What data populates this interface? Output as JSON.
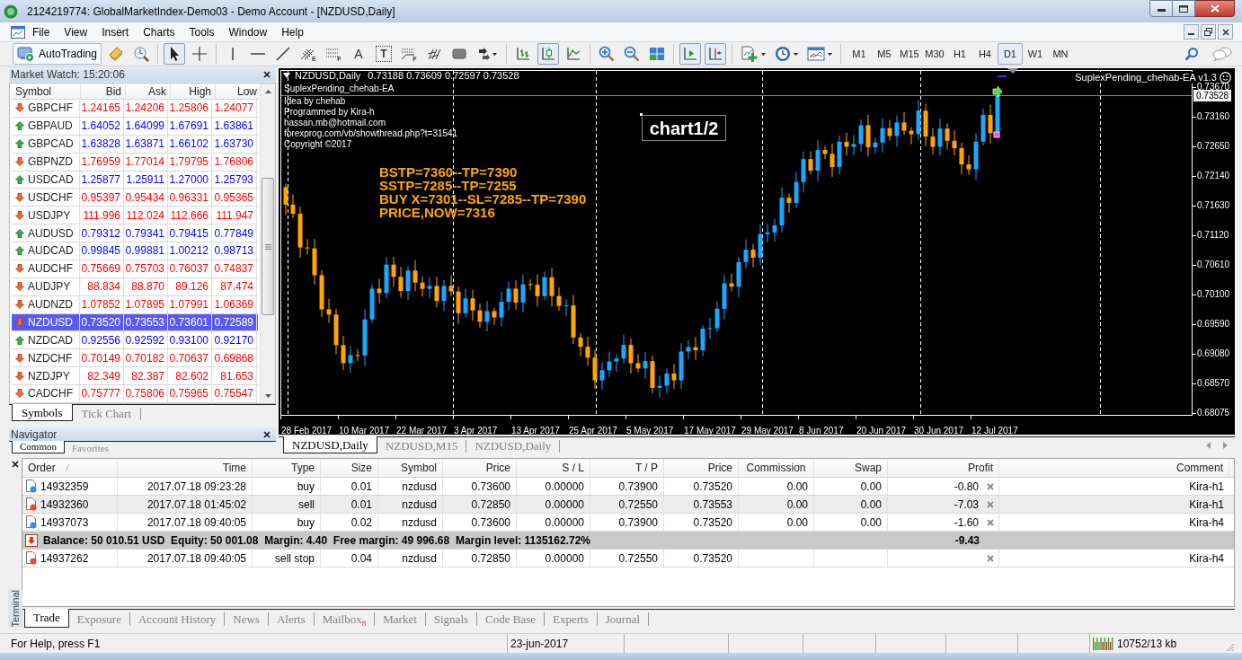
{
  "window": {
    "title": "2124219774: GlobalMarketIndex-Demo03 - Demo Account - [NZDUSD,Daily]"
  },
  "menu": [
    "File",
    "View",
    "Insert",
    "Charts",
    "Tools",
    "Window",
    "Help"
  ],
  "toolbar": {
    "groups": [
      [
        {
          "kind": "autotrading",
          "label": "AutoTrading"
        },
        {
          "kind": "new-order"
        },
        {
          "kind": "tester"
        }
      ],
      [
        {
          "kind": "cursor",
          "selected": true
        },
        {
          "kind": "crosshair",
          "selected": false
        }
      ],
      [
        {
          "kind": "vline"
        },
        {
          "kind": "hline"
        },
        {
          "kind": "trendline"
        },
        {
          "kind": "channel",
          "label": "E"
        },
        {
          "kind": "fibo",
          "label": "F"
        },
        {
          "kind": "text",
          "label": "A"
        },
        {
          "kind": "text-label",
          "label": "T"
        },
        {
          "kind": "fan",
          "label": "F"
        },
        {
          "kind": "gann"
        },
        {
          "kind": "rectangle"
        },
        {
          "kind": "arrows-menu"
        }
      ],
      [
        {
          "kind": "bars",
          "selected": false
        },
        {
          "kind": "candles",
          "selected": true
        },
        {
          "kind": "line",
          "selected": false
        }
      ],
      [
        {
          "kind": "zoom-in"
        },
        {
          "kind": "zoom-out"
        },
        {
          "kind": "tile"
        }
      ],
      [
        {
          "kind": "autoscroll",
          "selected": true
        },
        {
          "kind": "shift",
          "selected": true
        }
      ],
      [
        {
          "kind": "indicators"
        },
        {
          "kind": "periods"
        },
        {
          "kind": "templates"
        }
      ]
    ],
    "timeframes": [
      {
        "label": "M1",
        "selected": false
      },
      {
        "label": "M5",
        "selected": false
      },
      {
        "label": "M15",
        "selected": false
      },
      {
        "label": "M30",
        "selected": false
      },
      {
        "label": "H1",
        "selected": false
      },
      {
        "label": "H4",
        "selected": false
      },
      {
        "label": "D1",
        "selected": true
      },
      {
        "label": "W1",
        "selected": false
      },
      {
        "label": "MN",
        "selected": false
      }
    ]
  },
  "market_watch": {
    "title": "Market Watch: 15:20:06",
    "columns": [
      "Symbol",
      "Bid",
      "Ask",
      "High",
      "Low"
    ],
    "rows": [
      {
        "symbol": "GBPCHF",
        "bid": "1.24165",
        "ask": "1.24206",
        "high": "1.25806",
        "low": "1.24077",
        "up": false,
        "selected": false
      },
      {
        "symbol": "GBPAUD",
        "bid": "1.64052",
        "ask": "1.64099",
        "high": "1.67691",
        "low": "1.63861",
        "up": true,
        "selected": false
      },
      {
        "symbol": "GBPCAD",
        "bid": "1.63828",
        "ask": "1.63871",
        "high": "1.66102",
        "low": "1.63730",
        "up": true,
        "selected": false
      },
      {
        "symbol": "GBPNZD",
        "bid": "1.76959",
        "ask": "1.77014",
        "high": "1.79795",
        "low": "1.76806",
        "up": false,
        "selected": false
      },
      {
        "symbol": "USDCAD",
        "bid": "1.25877",
        "ask": "1.25911",
        "high": "1.27000",
        "low": "1.25793",
        "up": true,
        "selected": false
      },
      {
        "symbol": "USDCHF",
        "bid": "0.95397",
        "ask": "0.95434",
        "high": "0.96331",
        "low": "0.95365",
        "up": false,
        "selected": false
      },
      {
        "symbol": "USDJPY",
        "bid": "111.996",
        "ask": "112.024",
        "high": "112.666",
        "low": "111.947",
        "up": false,
        "selected": false
      },
      {
        "symbol": "AUDUSD",
        "bid": "0.79312",
        "ask": "0.79341",
        "high": "0.79415",
        "low": "0.77849",
        "up": true,
        "selected": false
      },
      {
        "symbol": "AUDCAD",
        "bid": "0.99845",
        "ask": "0.99881",
        "high": "1.00212",
        "low": "0.98713",
        "up": true,
        "selected": false
      },
      {
        "symbol": "AUDCHF",
        "bid": "0.75669",
        "ask": "0.75703",
        "high": "0.76037",
        "low": "0.74837",
        "up": false,
        "selected": false
      },
      {
        "symbol": "AUDJPY",
        "bid": "88.834",
        "ask": "88.870",
        "high": "89.126",
        "low": "87.474",
        "up": false,
        "selected": false
      },
      {
        "symbol": "AUDNZD",
        "bid": "1.07852",
        "ask": "1.07895",
        "high": "1.07991",
        "low": "1.06369",
        "up": false,
        "selected": false
      },
      {
        "symbol": "NZDUSD",
        "bid": "0.73520",
        "ask": "0.73553",
        "high": "0.73601",
        "low": "0.72589",
        "up": false,
        "selected": true
      },
      {
        "symbol": "NZDCAD",
        "bid": "0.92556",
        "ask": "0.92592",
        "high": "0.93100",
        "low": "0.92170",
        "up": true,
        "selected": false
      },
      {
        "symbol": "NZDCHF",
        "bid": "0.70149",
        "ask": "0.70182",
        "high": "0.70637",
        "low": "0.69868",
        "up": false,
        "selected": false
      },
      {
        "symbol": "NZDJPY",
        "bid": "82.349",
        "ask": "82.387",
        "high": "82.602",
        "low": "81.653",
        "up": false,
        "selected": false
      },
      {
        "symbol": "CADCHF",
        "bid": "0.75777",
        "ask": "0.75806",
        "high": "0.75965",
        "low": "0.75547",
        "up": false,
        "selected": false
      }
    ],
    "tabs": [
      {
        "label": "Symbols",
        "selected": true
      },
      {
        "label": "Tick Chart",
        "selected": false
      }
    ]
  },
  "navigator": {
    "title": "Navigator",
    "tabs": [
      {
        "label": "Common",
        "selected": true
      },
      {
        "label": "Favorites",
        "selected": false
      }
    ]
  },
  "chart": {
    "symbol": "NZDUSD,Daily",
    "ohlc": "0.73188 0.73609 0.72597 0.73528",
    "ea_name": "SuplexPending_chehab-EA",
    "info_lines": [
      "Idea by chehab",
      "Programmed by Kira-h",
      "hassan.mb@hotmail.com",
      "forexprog.com/vb/showthread.php?t=31541",
      "Copyright ©2017"
    ],
    "signal_lines": [
      "BSTP=7360--TP=7390",
      "SSTP=7285--TP=7255",
      "BUY X=7301--SL=7285--TP=7390",
      "PRICE,NOW=7316"
    ],
    "label_box": "chart1/2",
    "ea_badge": "SuplexPending_chehab-EA v1.3",
    "price_labels": [
      "0.73670",
      "0.73160",
      "0.72650",
      "0.72140",
      "0.71630",
      "0.71120",
      "0.70610",
      "0.70100",
      "0.69590",
      "0.69080",
      "0.68570",
      "0.68075"
    ],
    "current_price": "0.73528",
    "date_labels": [
      "28 Feb 2017",
      "10 Mar 2017",
      "22 Mar 2017",
      "3 Apr 2017",
      "13 Apr 2017",
      "25 Apr 2017",
      "5 May 2017",
      "17 May 2017",
      "29 May 2017",
      "8 Jun 2017",
      "20 Jun 2017",
      "30 Jun 2017",
      "12 Jul 2017"
    ]
  },
  "chart_tabs": [
    {
      "label": "NZDUSD,Daily",
      "selected": true
    },
    {
      "label": "NZDUSD,M15",
      "selected": false
    },
    {
      "label": "NZDUSD,Daily",
      "selected": false
    }
  ],
  "terminal": {
    "title": "Terminal",
    "columns": [
      "Order",
      "Time",
      "Type",
      "Size",
      "Symbol",
      "Price",
      "S / L",
      "T / P",
      "Price",
      "Commission",
      "Swap",
      "Profit",
      "Comment"
    ],
    "rows": [
      {
        "kind": "order",
        "color": "#2f8fe0",
        "order": "14932359",
        "time": "2017.07.18 09:23:28",
        "type": "buy",
        "size": "0.01",
        "symbol": "nzdusd",
        "price": "0.73600",
        "sl": "0.00000",
        "tp": "0.73900",
        "current": "0.73520",
        "commission": "0.00",
        "swap": "0.00",
        "profit": "-0.80",
        "comment": "Kira-h1"
      },
      {
        "kind": "order",
        "color": "#e0502a",
        "order": "14932360",
        "time": "2017.07.18 01:45:02",
        "type": "sell",
        "size": "0.01",
        "symbol": "nzdusd",
        "price": "0.72850",
        "sl": "0.00000",
        "tp": "0.72550",
        "current": "0.73553",
        "commission": "0.00",
        "swap": "0.00",
        "profit": "-7.03",
        "comment": "Kira-h1"
      },
      {
        "kind": "order",
        "color": "#2f8fe0",
        "order": "14937073",
        "time": "2017.07.18 09:40:05",
        "type": "buy",
        "size": "0.02",
        "symbol": "nzdusd",
        "price": "0.73600",
        "sl": "0.00000",
        "tp": "0.73900",
        "current": "0.73520",
        "commission": "0.00",
        "swap": "0.00",
        "profit": "-1.60",
        "comment": "Kira-h4"
      },
      {
        "kind": "summary",
        "text": "Balance: 50 010.51 USD  Equity: 50 001.08  Margin: 4.40  Free margin: 49 996.68  Margin level: 1135162.72%",
        "profit": "-9.43"
      },
      {
        "kind": "order",
        "color": "#e0502a",
        "order": "14937262",
        "time": "2017.07.18 09:40:05",
        "type": "sell stop",
        "size": "0.04",
        "symbol": "nzdusd",
        "price": "0.72850",
        "sl": "0.00000",
        "tp": "0.72550",
        "current": "0.73520",
        "comment": "Kira-h4"
      }
    ],
    "tabs": [
      {
        "label": "Trade",
        "selected": true
      },
      {
        "label": "Exposure",
        "selected": false
      },
      {
        "label": "Account History",
        "selected": false
      },
      {
        "label": "News",
        "selected": false
      },
      {
        "label": "Alerts",
        "selected": false
      },
      {
        "label": "Mailbox",
        "selected": false,
        "badge": "8"
      },
      {
        "label": "Market",
        "selected": false
      },
      {
        "label": "Signals",
        "selected": false
      },
      {
        "label": "Code Base",
        "selected": false
      },
      {
        "label": "Experts",
        "selected": false
      },
      {
        "label": "Journal",
        "selected": false
      }
    ]
  },
  "status_bar": {
    "help": "For Help, press F1",
    "date": "23-jun-2017",
    "traffic": "10752/13 kb"
  }
}
